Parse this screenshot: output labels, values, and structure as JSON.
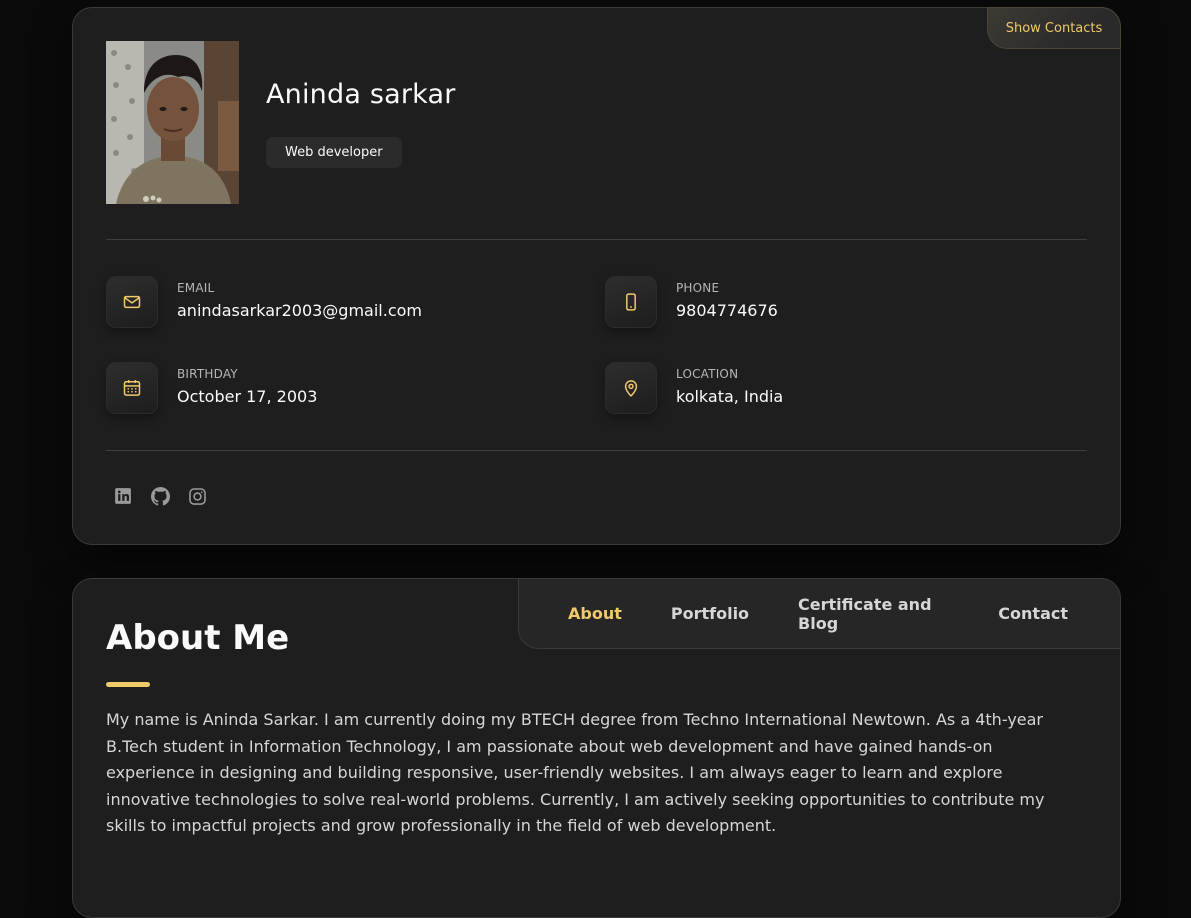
{
  "sidebar": {
    "show_contacts_label": "Show Contacts",
    "name": "Aninda sarkar",
    "role": "Web developer",
    "contacts": [
      {
        "icon": "mail-icon",
        "label": "EMAIL",
        "value": "anindasarkar2003@gmail.com"
      },
      {
        "icon": "phone-icon",
        "label": "PHONE",
        "value": "9804774676"
      },
      {
        "icon": "calendar-icon",
        "label": "BIRTHDAY",
        "value": "October 17, 2003"
      },
      {
        "icon": "location-icon",
        "label": "LOCATION",
        "value": "kolkata, India"
      }
    ],
    "social": [
      "linkedin-icon",
      "github-icon",
      "instagram-icon"
    ]
  },
  "navbar": {
    "links": [
      "About",
      "Portfolio",
      "Certificate and Blog",
      "Contact"
    ],
    "active": "About"
  },
  "about": {
    "title": "About Me",
    "text": "My name is Aninda Sarkar. I am currently doing my BTECH degree from Techno International Newtown. As a 4th-year B.Tech student in Information Technology, I am passionate about web development and have gained hands-on experience in designing and building responsive, user-friendly websites. I am always eager to learn and explore innovative technologies to solve real-world problems. Currently, I am actively seeking opportunities to contribute my skills to impactful projects and grow professionally in the field of web development."
  },
  "colors": {
    "accent": "#f0c96a",
    "background": "#0a0a0a",
    "card": "#1e1e1f",
    "text": "#fafafa",
    "muted_text": "#d6d6d6"
  }
}
